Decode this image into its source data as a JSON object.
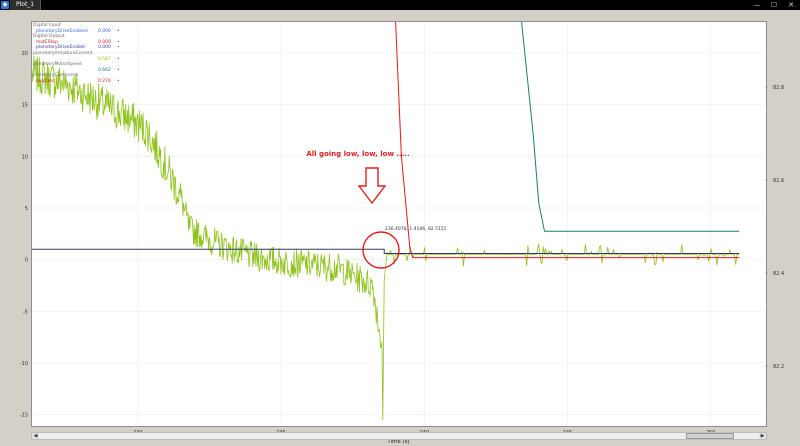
{
  "window": {
    "icon": "app-icon",
    "tab_title": "Plot_1",
    "minimize": "—",
    "maximize": "☐",
    "close": "✕"
  },
  "legend": {
    "groups": [
      {
        "title": "Digital Input",
        "rows": [
          {
            "name": "planetaryDriveEnabled",
            "value": "0.000",
            "color": "#3a66e5"
          }
        ]
      },
      {
        "title": "Digital Output",
        "rows": [
          {
            "name": "motEStop",
            "value": "0.000",
            "color": "#e01818"
          },
          {
            "name": "planetaryDriveEnable",
            "value": "0.000",
            "color": "#3b3ba8"
          }
        ]
      },
      {
        "title": "planetaryArmatureCurrent",
        "rows": [
          {
            "name": "",
            "value": "0.587",
            "color": "#8fc21b"
          }
        ]
      },
      {
        "title": "planetaryMotorSpeed",
        "rows": [
          {
            "name": "",
            "value": "0.662",
            "color": "#1a7d66"
          }
        ]
      },
      {
        "title": "planetaryCommand",
        "rows": [
          {
            "name": "engCmd",
            "value": "0.274",
            "color": "#e01818"
          }
        ]
      }
    ]
  },
  "annotation": {
    "text": "All going low, low, low .....",
    "color": "#e02020"
  },
  "cursor_readout": "236.4078, 1.4196, 82.5151",
  "chart_data": {
    "type": "line",
    "title": "",
    "xlabel": "Time (s)",
    "ylabel": "",
    "xlim": [
      226.3,
      251.9
    ],
    "ylim": [
      -16.0,
      23.0
    ],
    "ylim_right": [
      82.073,
      82.94
    ],
    "x_ticks": [
      230,
      235,
      240,
      245,
      250
    ],
    "y_ticks": [
      -15,
      -10,
      -5,
      0,
      5,
      10,
      15,
      20
    ],
    "y_ticks_right": [
      82.2,
      82.4,
      82.6,
      82.8
    ],
    "grid": true,
    "series": [
      {
        "name": "planetaryArmatureCurrent",
        "color": "#8fc21b",
        "x": [
          226.3,
          227.5,
          228.8,
          229.8,
          230.3,
          230.8,
          231.5,
          231.8,
          232.8,
          234.0,
          235.0,
          236.0,
          237.0,
          238.2,
          238.5,
          238.55,
          238.7,
          240.0,
          245.0,
          250.0,
          251.0
        ],
        "y": [
          18.0,
          17.0,
          15.0,
          13.5,
          12.5,
          10.0,
          6.0,
          3.0,
          1.5,
          0.3,
          -0.2,
          -0.5,
          -0.8,
          -2.5,
          -8.0,
          -15.5,
          0.7,
          0.5,
          0.5,
          0.5,
          0.5
        ]
      },
      {
        "name": "planetaryMotorSpeed",
        "color": "#1a7d66",
        "x": [
          243.4,
          243.8,
          244.0,
          244.2,
          245.0,
          250.0,
          251.0
        ],
        "y": [
          82.94,
          82.7,
          82.55,
          82.49,
          82.49,
          82.49,
          82.49
        ]
      },
      {
        "name": "motEStop",
        "color": "#e01818",
        "x": [
          239.0,
          239.2,
          239.5,
          239.6,
          240.0,
          250.0,
          251.0
        ],
        "y": [
          23.0,
          10.0,
          1.0,
          0.2,
          0.2,
          0.2,
          0.2
        ]
      },
      {
        "name": "planetaryDriveEnable",
        "color": "#303a6a",
        "x": [
          226.3,
          237.5,
          238.6,
          238.6,
          240.0,
          251.0
        ],
        "y": [
          1.0,
          1.0,
          1.0,
          0.6,
          0.6,
          0.6
        ]
      }
    ]
  }
}
